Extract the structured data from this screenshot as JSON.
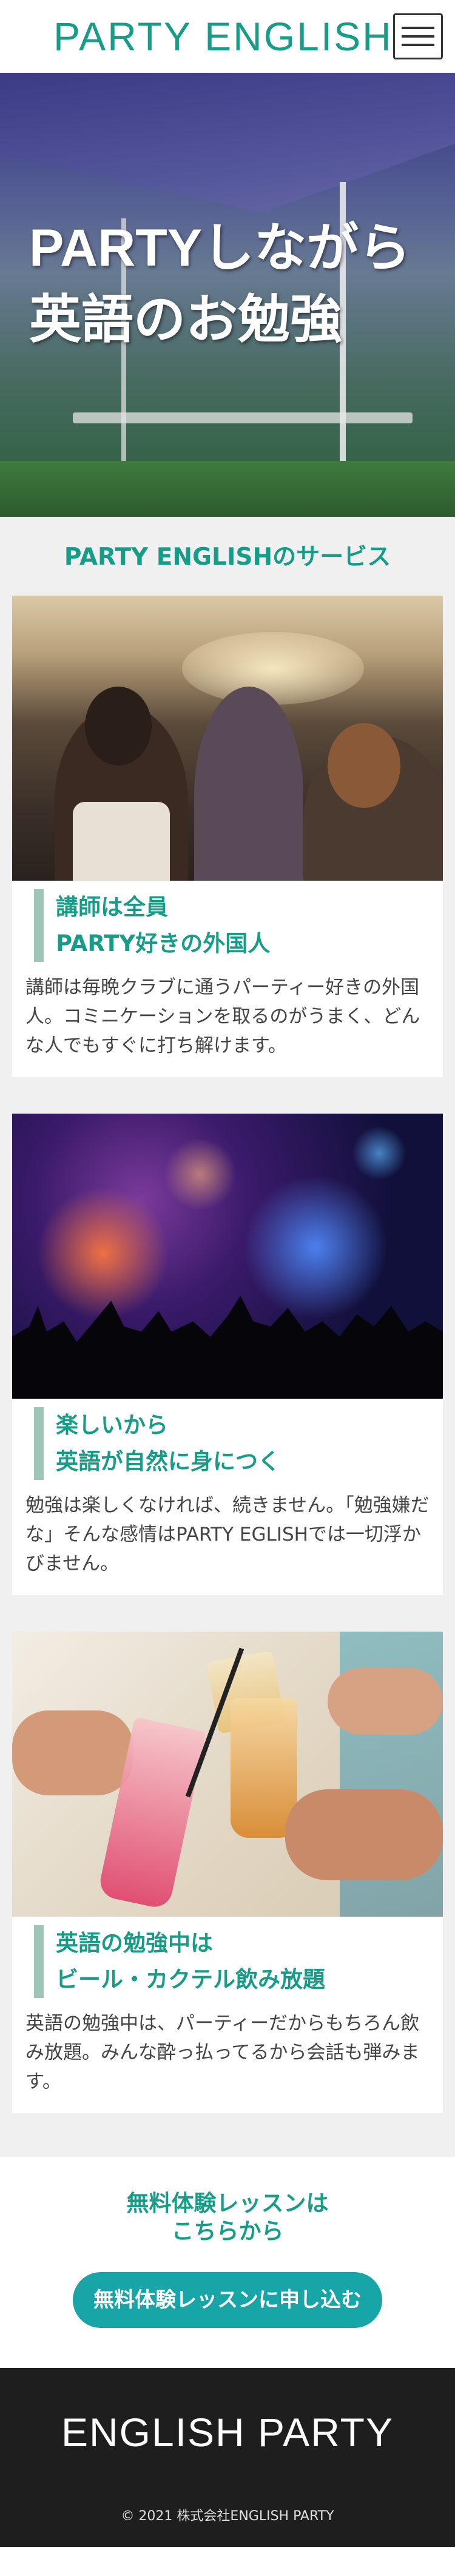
{
  "header": {
    "logo": "PARTY ENGLISH",
    "menu_icon": "hamburger-icon"
  },
  "hero": {
    "title_line1": "PARTYしながら",
    "title_line2": "英語のお勉強"
  },
  "services": {
    "title": "PARTY ENGLISHのサービス",
    "cards": [
      {
        "heading_line1": "講師は全員",
        "heading_line2": "PARTY好きの外国人",
        "text": "講師は毎晩クラブに通うパーティー好きの外国人。コミニケーションを取るのがうまく、どんな人でもすぐに打ち解けます。"
      },
      {
        "heading_line1": "楽しいから",
        "heading_line2": "英語が自然に身につく",
        "text": "勉強は楽しくなければ、続きません。「勉強嫌だな」そんな感情はPARTY EGLISHでは一切浮かびません。"
      },
      {
        "heading_line1": "英語の勉強中は",
        "heading_line2": "ビール・カクテル飲み放題",
        "text": "英語の勉強中は、パーティーだからもちろん飲み放題。みんな酔っ払ってるから会話も弾みます。"
      }
    ]
  },
  "cta": {
    "text_line1": "無料体験レッスンは",
    "text_line2": "こちらから",
    "button_label": "無料体験レッスンに申し込む"
  },
  "footer": {
    "logo": "ENGLISH PARTY",
    "copyright": "© 2021 株式会社ENGLISH PARTY"
  },
  "colors": {
    "brand": "#169c87",
    "accent_bar": "#9cc7b8",
    "button": "#17a5a8",
    "footer_bg": "#1e1e1e"
  }
}
